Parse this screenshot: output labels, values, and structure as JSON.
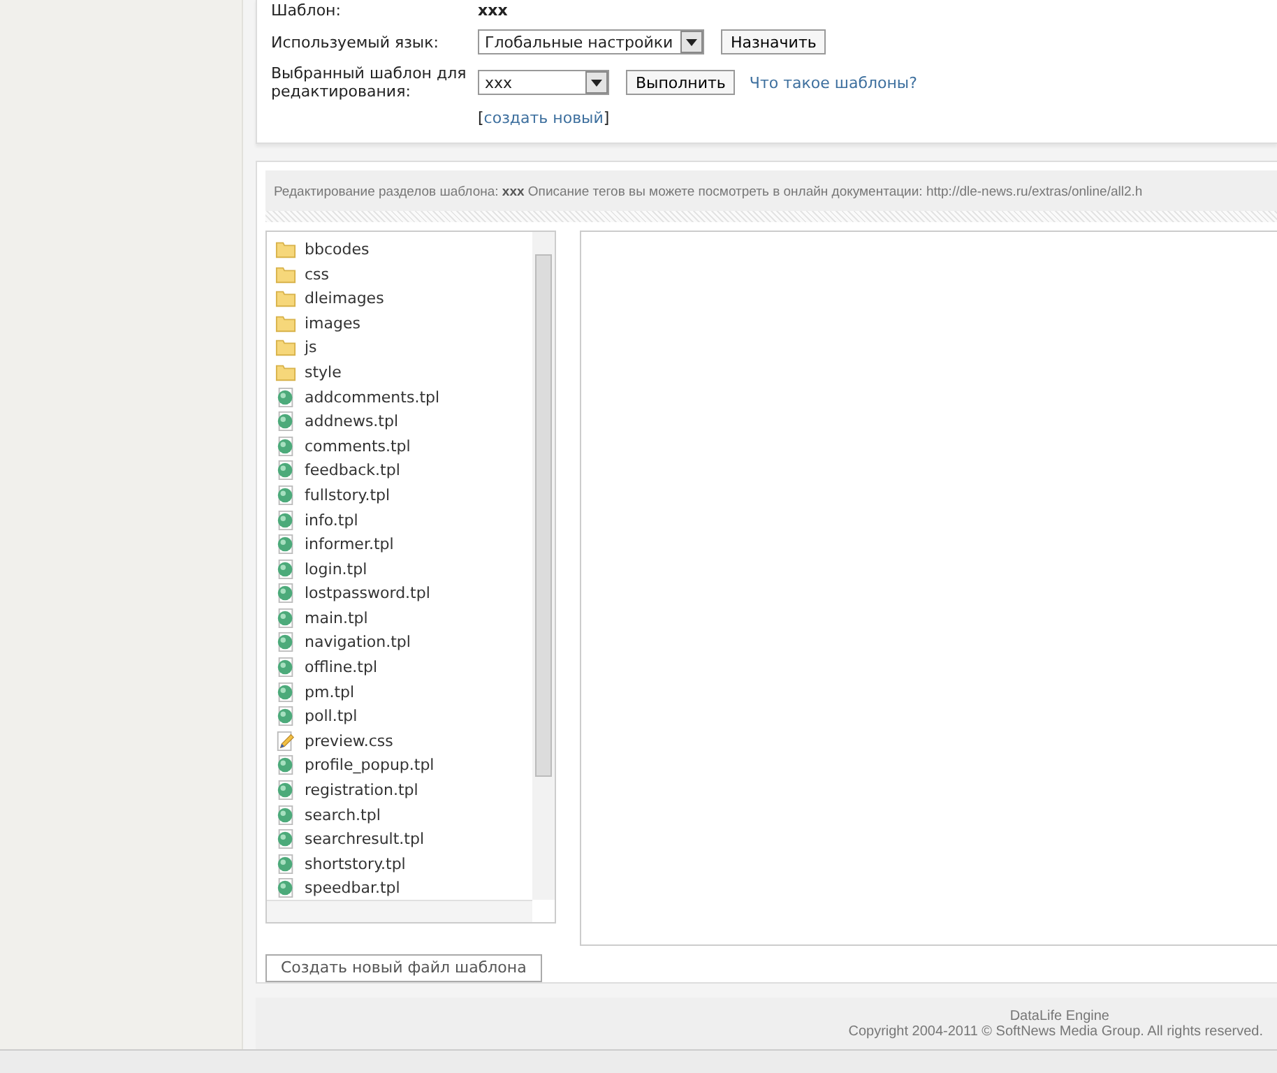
{
  "settings": {
    "template_label": "Шаблон:",
    "template_value": "xxx",
    "language_label": "Используемый язык:",
    "language_value": "Глобальные настройки",
    "assign_button": "Назначить",
    "edit_label": "Выбранный шаблон для редактирования:",
    "edit_value": "xxx",
    "run_button": "Выполнить",
    "help_link": "Что такое шаблоны?",
    "create_open": "[",
    "create_link": "создать новый",
    "create_close": "]"
  },
  "editor": {
    "header_prefix": "Редактирование разделов шаблона:",
    "header_name": "xxx",
    "header_text": "Описание тегов вы можете посмотреть в онлайн документации: http://dle-news.ru/extras/online/all2.h",
    "files": [
      {
        "name": "bbcodes",
        "kind": "folder"
      },
      {
        "name": "css",
        "kind": "folder"
      },
      {
        "name": "dleimages",
        "kind": "folder"
      },
      {
        "name": "images",
        "kind": "folder"
      },
      {
        "name": "js",
        "kind": "folder"
      },
      {
        "name": "style",
        "kind": "folder"
      },
      {
        "name": "addcomments.tpl",
        "kind": "template"
      },
      {
        "name": "addnews.tpl",
        "kind": "template"
      },
      {
        "name": "comments.tpl",
        "kind": "template"
      },
      {
        "name": "feedback.tpl",
        "kind": "template"
      },
      {
        "name": "fullstory.tpl",
        "kind": "template"
      },
      {
        "name": "info.tpl",
        "kind": "template"
      },
      {
        "name": "informer.tpl",
        "kind": "template"
      },
      {
        "name": "login.tpl",
        "kind": "template"
      },
      {
        "name": "lostpassword.tpl",
        "kind": "template"
      },
      {
        "name": "main.tpl",
        "kind": "template"
      },
      {
        "name": "navigation.tpl",
        "kind": "template"
      },
      {
        "name": "offline.tpl",
        "kind": "template"
      },
      {
        "name": "pm.tpl",
        "kind": "template"
      },
      {
        "name": "poll.tpl",
        "kind": "template"
      },
      {
        "name": "preview.css",
        "kind": "css"
      },
      {
        "name": "profile_popup.tpl",
        "kind": "template"
      },
      {
        "name": "registration.tpl",
        "kind": "template"
      },
      {
        "name": "search.tpl",
        "kind": "template"
      },
      {
        "name": "searchresult.tpl",
        "kind": "template"
      },
      {
        "name": "shortstory.tpl",
        "kind": "template"
      },
      {
        "name": "speedbar.tpl",
        "kind": "template"
      }
    ],
    "new_file_button": "Создать новый файл шаблона"
  },
  "footer": {
    "product": "DataLife Engine",
    "copyright": "Copyright 2004-2011 © SoftNews Media Group. All rights reserved."
  }
}
